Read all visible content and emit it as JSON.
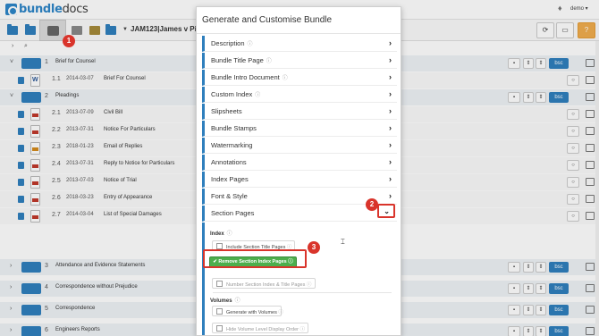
{
  "app": {
    "logo_prefix": "bundle",
    "logo_suffix": "docs",
    "user": "demo"
  },
  "toolbar": {
    "case_title": "JAM123|James v Pipe"
  },
  "badges": {
    "b1": "1",
    "b2": "2",
    "b3": "3"
  },
  "list_rows": [
    {
      "kind": "sec",
      "num": "1",
      "title": "Brief for Counsel"
    },
    {
      "kind": "doc",
      "num": "1.1",
      "date": "2014-03-07",
      "title": "Brief For Counsel",
      "icon": "word"
    },
    {
      "kind": "sec",
      "num": "2",
      "title": "Pleadings"
    },
    {
      "kind": "doc",
      "num": "2.1",
      "date": "2013-07-09",
      "title": "Civil Bill",
      "icon": "pdf"
    },
    {
      "kind": "doc",
      "num": "2.2",
      "date": "2013-07-31",
      "title": "Notice For Particulars",
      "icon": "pdf"
    },
    {
      "kind": "doc",
      "num": "2.3",
      "date": "2018-01-23",
      "title": "Email of Replies",
      "icon": "gold"
    },
    {
      "kind": "doc",
      "num": "2.4",
      "date": "2013-07-31",
      "title": "Reply to Notice for Particulars",
      "icon": "pdf"
    },
    {
      "kind": "doc",
      "num": "2.5",
      "date": "2013-07-03",
      "title": "Notice of Trial",
      "icon": "pdf"
    },
    {
      "kind": "doc",
      "num": "2.6",
      "date": "2018-03-23",
      "title": "Entry of Appearance",
      "icon": "pdf"
    },
    {
      "kind": "doc",
      "num": "2.7",
      "date": "2014-03-04",
      "title": "List of Special Damages",
      "icon": "pdf"
    },
    {
      "kind": "sec",
      "num": "3",
      "title": "Attendance and Evidence Statements"
    },
    {
      "kind": "sec",
      "num": "4",
      "title": "Correspondence without Prejudice"
    },
    {
      "kind": "sec",
      "num": "5",
      "title": "Correspondence"
    },
    {
      "kind": "sec",
      "num": "6",
      "title": "Engineers Reports"
    }
  ],
  "row_controls": {
    "bsc": "bsc",
    "updown": "⇕"
  },
  "modal": {
    "title": "Generate and Customise Bundle",
    "sections": [
      {
        "label": "Description",
        "info": true
      },
      {
        "label": "Bundle Title Page",
        "info": true
      },
      {
        "label": "Bundle Intro Document",
        "info": true
      },
      {
        "label": "Custom Index",
        "info": true
      },
      {
        "label": "Slipsheets",
        "info": false
      },
      {
        "label": "Bundle Stamps",
        "info": false
      },
      {
        "label": "Watermarking",
        "info": false
      },
      {
        "label": "Annotations",
        "info": false
      },
      {
        "label": "Index Pages",
        "info": false
      },
      {
        "label": "Font & Style",
        "info": false
      },
      {
        "label": "Section Pages",
        "info": false
      }
    ],
    "section_pages": {
      "index_heading": "Index",
      "include_section_title_pages": "Include Section Title Pages",
      "remove_section_index_pages": "Remove Section Index Pages",
      "number_section_index_title_pages": "Number Section Index & Title Pages",
      "volumes_heading": "Volumes",
      "generate_with_volumes": "Generate with Volumes",
      "hide_volume_level_display_order": "Hide Volume Level Display Order"
    }
  },
  "colors": {
    "accent": "#2f7fbd",
    "badge": "#d9342b",
    "green": "#4cae4c",
    "help": "#f0ad4e"
  }
}
